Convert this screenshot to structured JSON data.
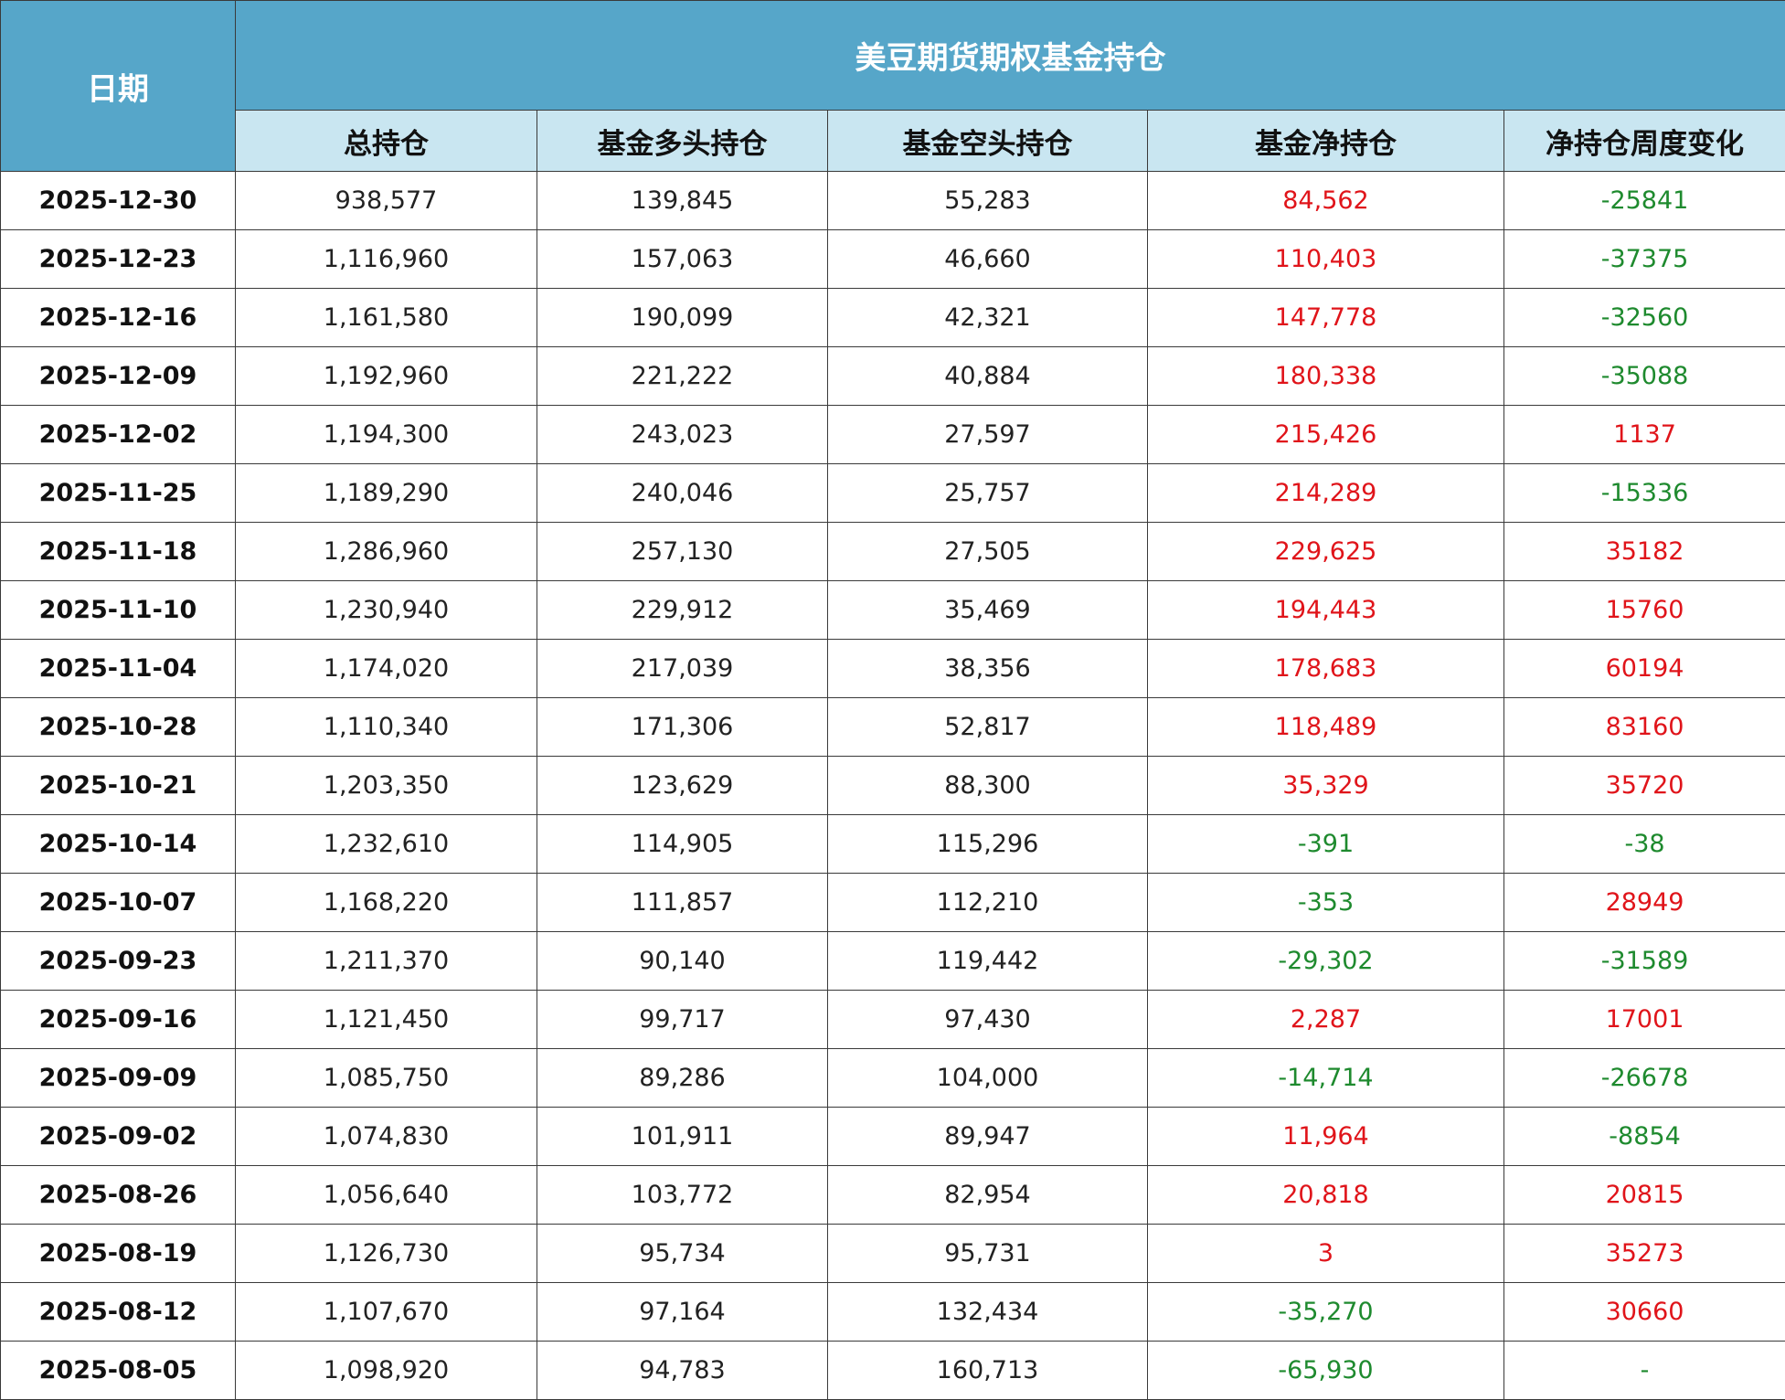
{
  "table": {
    "date_header": "日期",
    "title": "美豆期货期权基金持仓",
    "columns": [
      "总持仓",
      "基金多头持仓",
      "基金空头持仓",
      "基金净持仓",
      "净持仓周度变化"
    ],
    "rows": [
      {
        "date": "2025-12-30",
        "total": "938,577",
        "long": "139,845",
        "short": "55,283",
        "net": "84,562",
        "change": "-25841"
      },
      {
        "date": "2025-12-23",
        "total": "1,116,960",
        "long": "157,063",
        "short": "46,660",
        "net": "110,403",
        "change": "-37375"
      },
      {
        "date": "2025-12-16",
        "total": "1,161,580",
        "long": "190,099",
        "short": "42,321",
        "net": "147,778",
        "change": "-32560"
      },
      {
        "date": "2025-12-09",
        "total": "1,192,960",
        "long": "221,222",
        "short": "40,884",
        "net": "180,338",
        "change": "-35088"
      },
      {
        "date": "2025-12-02",
        "total": "1,194,300",
        "long": "243,023",
        "short": "27,597",
        "net": "215,426",
        "change": "1137"
      },
      {
        "date": "2025-11-25",
        "total": "1,189,290",
        "long": "240,046",
        "short": "25,757",
        "net": "214,289",
        "change": "-15336"
      },
      {
        "date": "2025-11-18",
        "total": "1,286,960",
        "long": "257,130",
        "short": "27,505",
        "net": "229,625",
        "change": "35182"
      },
      {
        "date": "2025-11-10",
        "total": "1,230,940",
        "long": "229,912",
        "short": "35,469",
        "net": "194,443",
        "change": "15760"
      },
      {
        "date": "2025-11-04",
        "total": "1,174,020",
        "long": "217,039",
        "short": "38,356",
        "net": "178,683",
        "change": "60194"
      },
      {
        "date": "2025-10-28",
        "total": "1,110,340",
        "long": "171,306",
        "short": "52,817",
        "net": "118,489",
        "change": "83160"
      },
      {
        "date": "2025-10-21",
        "total": "1,203,350",
        "long": "123,629",
        "short": "88,300",
        "net": "35,329",
        "change": "35720"
      },
      {
        "date": "2025-10-14",
        "total": "1,232,610",
        "long": "114,905",
        "short": "115,296",
        "net": "-391",
        "change": "-38"
      },
      {
        "date": "2025-10-07",
        "total": "1,168,220",
        "long": "111,857",
        "short": "112,210",
        "net": "-353",
        "change": "28949"
      },
      {
        "date": "2025-09-23",
        "total": "1,211,370",
        "long": "90,140",
        "short": "119,442",
        "net": "-29,302",
        "change": "-31589"
      },
      {
        "date": "2025-09-16",
        "total": "1,121,450",
        "long": "99,717",
        "short": "97,430",
        "net": "2,287",
        "change": "17001"
      },
      {
        "date": "2025-09-09",
        "total": "1,085,750",
        "long": "89,286",
        "short": "104,000",
        "net": "-14,714",
        "change": "-26678"
      },
      {
        "date": "2025-09-02",
        "total": "1,074,830",
        "long": "101,911",
        "short": "89,947",
        "net": "11,964",
        "change": "-8854"
      },
      {
        "date": "2025-08-26",
        "total": "1,056,640",
        "long": "103,772",
        "short": "82,954",
        "net": "20,818",
        "change": "20815"
      },
      {
        "date": "2025-08-19",
        "total": "1,126,730",
        "long": "95,734",
        "short": "95,731",
        "net": "3",
        "change": "35273"
      },
      {
        "date": "2025-08-12",
        "total": "1,107,670",
        "long": "97,164",
        "short": "132,434",
        "net": "-35,270",
        "change": "30660"
      },
      {
        "date": "2025-08-05",
        "total": "1,098,920",
        "long": "94,783",
        "short": "160,713",
        "net": "-65,930",
        "change": "-"
      }
    ]
  },
  "colors": {
    "header_bg": "#56a6c9",
    "subheader_bg": "#c9e6f1",
    "positive": "#e0141a",
    "negative": "#1e8a2e"
  }
}
